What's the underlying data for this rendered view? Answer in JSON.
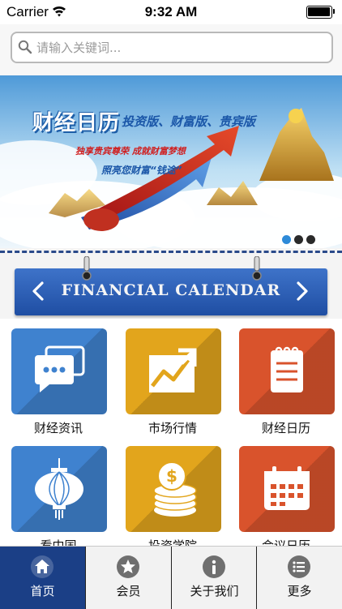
{
  "status_bar": {
    "carrier": "Carrier",
    "time": "9:32 AM"
  },
  "search": {
    "placeholder": "请输入关键词..."
  },
  "banner": {
    "title": "财经日历",
    "editions": "投资版、财富版、贵宾版",
    "slogan1": "独享贵宾尊荣  成就财富梦想",
    "slogan2": "照亮您财富“钱途”",
    "dot_count": 3,
    "active_dot": 0
  },
  "calendar": {
    "title": "FINANCIAL CALENDAR"
  },
  "tiles": [
    {
      "label": "财经资讯",
      "color": "#3f82cf",
      "icon": "chat-bubbles-icon"
    },
    {
      "label": "市场行情",
      "color": "#e2a51c",
      "icon": "trend-chart-icon"
    },
    {
      "label": "财经日历",
      "color": "#d9532c",
      "icon": "notepad-icon"
    },
    {
      "label": "看中国",
      "color": "#3f82cf",
      "icon": "lantern-icon"
    },
    {
      "label": "投资学院",
      "color": "#e2a51c",
      "icon": "coins-icon"
    },
    {
      "label": "会议日历",
      "color": "#d9532c",
      "icon": "calendar-icon"
    }
  ],
  "tabs": [
    {
      "label": "首页",
      "icon": "home-icon",
      "active": true
    },
    {
      "label": "会员",
      "icon": "star-icon",
      "active": false
    },
    {
      "label": "关于我们",
      "icon": "info-icon",
      "active": false
    },
    {
      "label": "更多",
      "icon": "list-icon",
      "active": false
    }
  ],
  "colors": {
    "active_tab": "#1b3f86",
    "calendar_strip": "#2f5fb8"
  }
}
